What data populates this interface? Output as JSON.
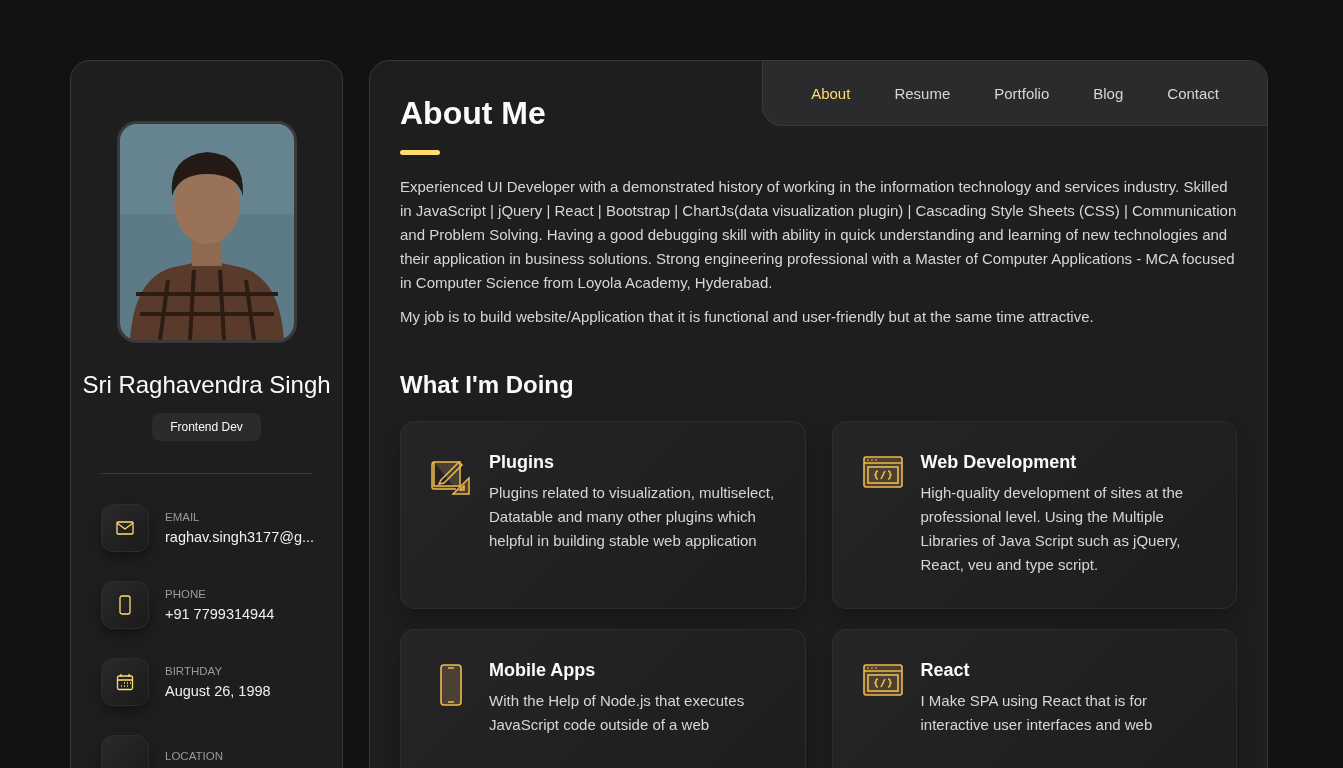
{
  "profile": {
    "name": "Sri Raghavendra Singh",
    "title": "Frontend Dev",
    "contacts": [
      {
        "kind": "email",
        "label": "EMAIL",
        "value": "raghav.singh3177@g..."
      },
      {
        "kind": "phone",
        "label": "PHONE",
        "value": "+91 7799314944"
      },
      {
        "kind": "birthday",
        "label": "BIRTHDAY",
        "value": "August 26, 1998"
      },
      {
        "kind": "location",
        "label": "LOCATION"
      }
    ]
  },
  "nav": [
    {
      "label": "About",
      "selected": true
    },
    {
      "label": "Resume",
      "selected": false
    },
    {
      "label": "Portfolio",
      "selected": false
    },
    {
      "label": "Blog",
      "selected": false
    },
    {
      "label": "Contact",
      "selected": false
    }
  ],
  "about": {
    "title": "About Me",
    "paragraphs": [
      "Experienced UI Developer with a demonstrated history of working in the information technology and services industry. Skilled in JavaScript | jQuery | React | Bootstrap | ChartJs(data visualization plugin) | Cascading Style Sheets (CSS) | Communication and Problem Solving. Having a good debugging skill with ability in quick understanding and learning of new technologies and their application in business solutions. Strong engineering professional with a Master of Computer Applications - MCA focused in Computer Science from Loyola Academy, Hyderabad.",
      "My job is to build website/Application that it is functional and user-friendly but at the same time attractive."
    ]
  },
  "services": {
    "title": "What I'm Doing",
    "items": [
      {
        "kind": "design",
        "title": "Plugins",
        "text": "Plugins related to visualization, multiselect, Datatable and many other plugins which helpful in building stable web application"
      },
      {
        "kind": "code",
        "title": "Web Development",
        "text": "High-quality development of sites at the professional level. Using the Multiple Libraries of Java Script such as jQuery, React, veu and type script."
      },
      {
        "kind": "mobile",
        "title": "Mobile Apps",
        "text": "With the Help of Node.js that executes JavaScript code outside of a web"
      },
      {
        "kind": "code",
        "title": "React",
        "text": "I Make SPA using React that is for interactive user interfaces and web"
      }
    ]
  }
}
